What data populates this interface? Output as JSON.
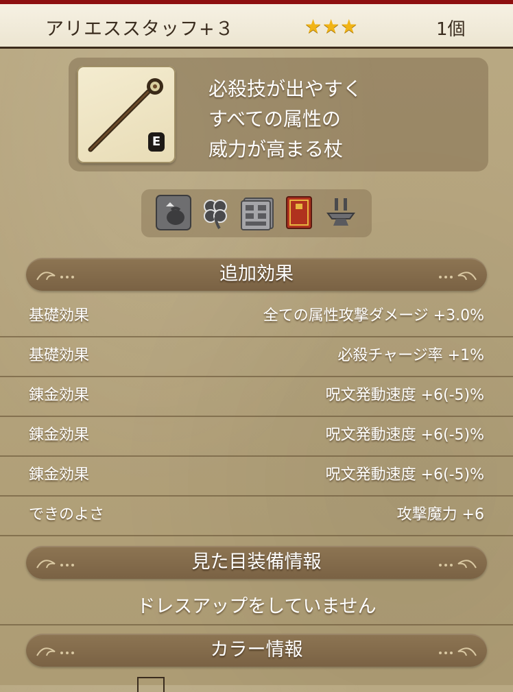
{
  "header": {
    "item_name": "アリエススタッフ+３",
    "stars": "★★★",
    "quantity": "1個"
  },
  "item": {
    "equip_badge": "E",
    "description": "必殺技が出やすく\nすべての属性の\n威力が高まる杖"
  },
  "traits": [
    {
      "icon": "bag-return-icon"
    },
    {
      "icon": "clover-icon"
    },
    {
      "icon": "storage-drawer-icon"
    },
    {
      "icon": "red-book-icon"
    },
    {
      "icon": "anvil-icon"
    }
  ],
  "sections": {
    "effects_title": "追加効果",
    "appearance_title": "見た目装備情報",
    "color_title": "カラー情報"
  },
  "effects": [
    {
      "label": "基礎効果",
      "value": "全ての属性攻撃ダメージ +3.0%"
    },
    {
      "label": "基礎効果",
      "value": "必殺チャージ率 +1%"
    },
    {
      "label": "錬金効果",
      "value": "呪文発動速度 +6(-5)%"
    },
    {
      "label": "錬金効果",
      "value": "呪文発動速度 +6(-5)%"
    },
    {
      "label": "錬金効果",
      "value": "呪文発動速度 +6(-5)%"
    },
    {
      "label": "できのよさ",
      "value": "攻撃魔力 +6"
    }
  ],
  "appearance": {
    "status_text": "ドレスアップをしていません"
  },
  "colors": {
    "header_bg": "#ece5d1",
    "star": "#f1b416",
    "section_bar": "#8d7553",
    "top_accent": "#8e1010"
  }
}
